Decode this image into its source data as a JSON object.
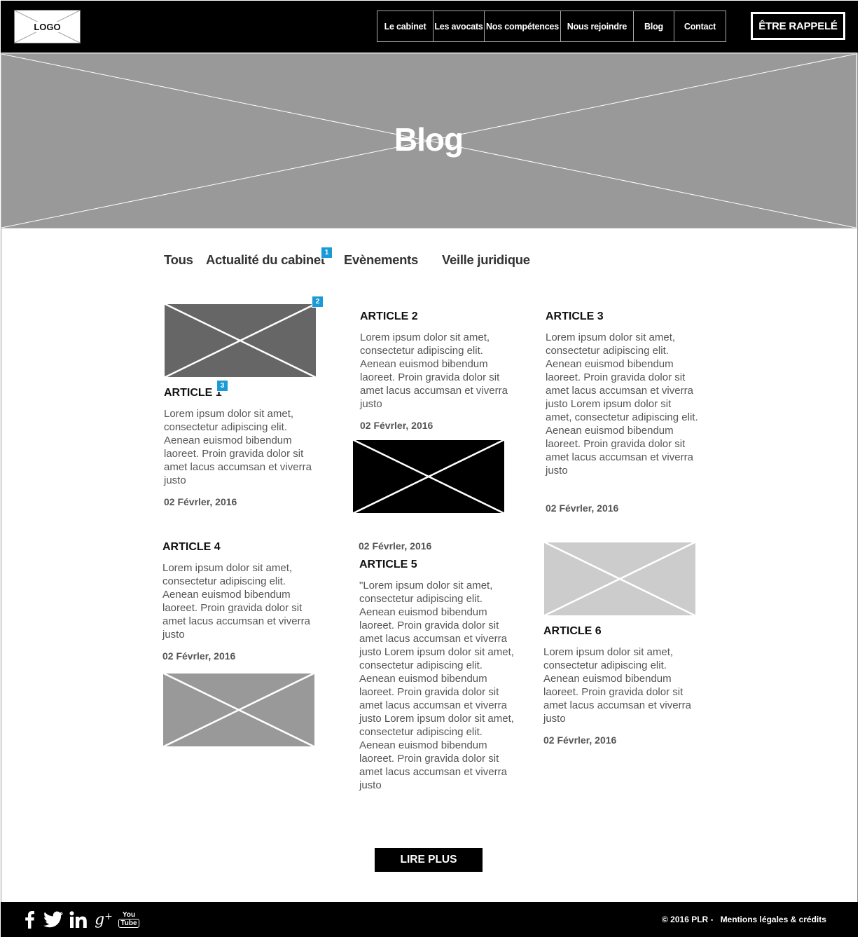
{
  "header": {
    "logo": "LOGO",
    "nav": [
      {
        "label": "Le cabinet"
      },
      {
        "label": "Les avocats"
      },
      {
        "label": "Nos compétences"
      },
      {
        "label": "Nous rejoindre"
      },
      {
        "label": "Blog"
      },
      {
        "label": "Contact"
      }
    ],
    "callback": "ÊTRE RAPPELÉ"
  },
  "hero": {
    "title": "Blog"
  },
  "tabs": [
    {
      "label": "Tous"
    },
    {
      "label": "Actualité du cabinet",
      "badge": "1"
    },
    {
      "label": "Evènements"
    },
    {
      "label": "Veille juridique"
    }
  ],
  "articles": [
    {
      "title": "ARTICLE 1",
      "badge_image": "2",
      "badge_title": "3",
      "text": "Lorem ipsum dolor sit amet, consectetur adipiscing elit. Aenean euismod bibendum laoreet. Proin gravida dolor sit amet lacus accumsan et viverra justo",
      "date": "02 Févrler, 2016",
      "image_color": "#666666"
    },
    {
      "title": "ARTICLE 2",
      "text": "Lorem ipsum dolor sit amet, consectetur adipiscing elit. Aenean euismod bibendum laoreet. Proin gravida dolor sit amet lacus accumsan et viverra justo",
      "date": "02 Févrler, 2016",
      "image_color": "#000000"
    },
    {
      "title": "ARTICLE 3",
      "text": "Lorem ipsum dolor sit amet, consectetur adipiscing elit. Aenean euismod bibendum laoreet. Proin gravida dolor sit amet lacus accumsan et viverra justo Lorem ipsum dolor sit amet, consectetur adipiscing elit. Aenean euismod bibendum laoreet. Proin gravida dolor sit amet lacus accumsan et viverra justo",
      "date": "02 Févrler, 2016"
    },
    {
      "title": "ARTICLE 4",
      "text": "Lorem ipsum dolor sit amet, consectetur adipiscing elit. Aenean euismod bibendum laoreet. Proin gravida dolor sit amet lacus accumsan et viverra justo",
      "date": "02 Févrler, 2016",
      "image_color": "#999999"
    },
    {
      "title": "ARTICLE 5",
      "text": "\"Lorem ipsum dolor sit amet, consectetur adipiscing elit. Aenean euismod bibendum laoreet. Proin gravida dolor sit amet lacus accumsan et viverra justo Lorem ipsum dolor sit amet, consectetur adipiscing elit. Aenean euismod bibendum laoreet. Proin gravida dolor sit amet lacus accumsan et viverra justo Lorem ipsum dolor sit amet, consectetur adipiscing elit. Aenean euismod bibendum laoreet. Proin gravida dolor sit amet lacus accumsan et viverra justo",
      "date": "02 Févrler, 2016"
    },
    {
      "title": "ARTICLE 6",
      "text": "Lorem ipsum dolor sit amet, consectetur adipiscing elit. Aenean euismod bibendum laoreet. Proin gravida dolor sit amet lacus accumsan et viverra justo",
      "date": "02 Févrler, 2016",
      "image_color": "#cccccc"
    }
  ],
  "more_button": "LIRE PLUS",
  "footer": {
    "social": [
      {
        "icon": "facebook-icon",
        "glyph": "f"
      },
      {
        "icon": "twitter-icon",
        "glyph": "twitter"
      },
      {
        "icon": "linkedin-icon",
        "glyph": "in"
      },
      {
        "icon": "google-plus-icon",
        "glyph": "g+"
      },
      {
        "icon": "youtube-icon",
        "glyph": "You Tube"
      }
    ],
    "copyright": "© 2016 PLR  -",
    "legal_link": "Mentions légales & crédits"
  },
  "colors": {
    "accent": "#1a9ad6",
    "header_bg": "#000000",
    "hero_bg": "#999999"
  }
}
